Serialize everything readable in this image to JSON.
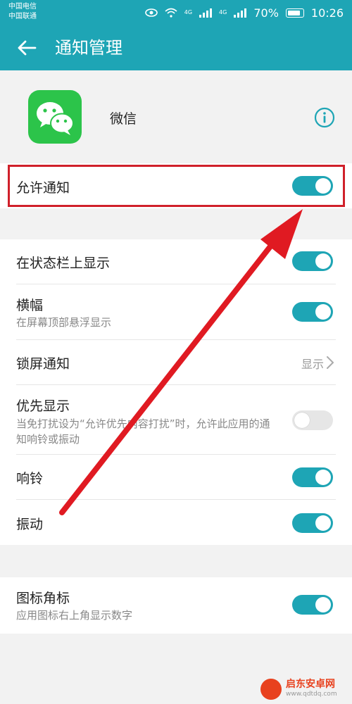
{
  "status_bar": {
    "carrier1": "中国电信",
    "carrier2": "中国联通",
    "net1": "4G",
    "net2": "4G",
    "battery": "70%",
    "time": "10:26"
  },
  "app_bar": {
    "title": "通知管理"
  },
  "app_info": {
    "name": "微信"
  },
  "settings": {
    "allow_notifications": {
      "label": "允许通知",
      "enabled": true
    },
    "status_bar_display": {
      "label": "在状态栏上显示",
      "enabled": true
    },
    "banner": {
      "label": "横幅",
      "sub": "在屏幕顶部悬浮显示",
      "enabled": true
    },
    "lock_screen": {
      "label": "锁屏通知",
      "value": "显示"
    },
    "priority_display": {
      "label": "优先显示",
      "sub": "当免打扰设为“允许优先内容打扰”时，允许此应用的通知响铃或振动",
      "enabled": false
    },
    "ringtone": {
      "label": "响铃",
      "enabled": true
    },
    "vibration": {
      "label": "振动",
      "enabled": true
    },
    "badge": {
      "label": "图标角标",
      "sub": "应用图标右上角显示数字",
      "enabled": true
    }
  },
  "watermark": {
    "title": "启东安卓网",
    "url": "www.qdtdq.com"
  },
  "colors": {
    "accent": "#1ea5b5",
    "highlight": "#d0202a",
    "arrow": "#e01a22",
    "app_logo": "#2cc44a"
  }
}
